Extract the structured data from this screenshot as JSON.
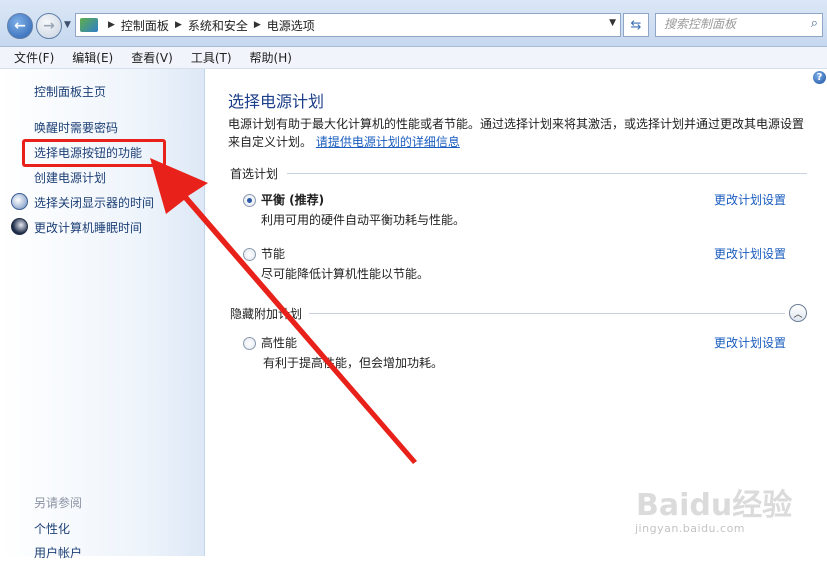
{
  "address_bar": {
    "crumbs": [
      "控制面板",
      "系统和安全",
      "电源选项"
    ],
    "search_placeholder": "搜索控制面板"
  },
  "menu": {
    "items": [
      "文件(F)",
      "编辑(E)",
      "查看(V)",
      "工具(T)",
      "帮助(H)"
    ]
  },
  "sidebar": {
    "links": [
      "控制面板主页",
      "唤醒时需要密码",
      "选择电源按钮的功能",
      "创建电源计划",
      "选择关闭显示器的时间",
      "更改计算机睡眠时间"
    ],
    "see_also_label": "另请参阅",
    "see_also": [
      "个性化",
      "用户帐户"
    ]
  },
  "main": {
    "title": "选择电源计划",
    "description": "电源计划有助于最大化计算机的性能或者节能。通过选择计划来将其激活，或选择计划并通过更改其电源设置来自定义计划。",
    "info_link": "请提供电源计划的详细信息",
    "preferred_group": "首选计划",
    "hidden_group": "隐藏附加计划",
    "plans": [
      {
        "name": "平衡 (推荐)",
        "desc": "利用可用的硬件自动平衡功耗与性能。",
        "selected": true,
        "change": "更改计划设置"
      },
      {
        "name": "节能",
        "desc": "尽可能降低计算机性能以节能。",
        "selected": false,
        "change": "更改计划设置"
      },
      {
        "name": "高性能",
        "desc": "有利于提高性能，但会增加功耗。",
        "selected": false,
        "change": "更改计划设置"
      }
    ]
  },
  "watermark": {
    "brand": "Baidu经验",
    "url": "jingyan.baidu.com"
  },
  "colors": {
    "link": "#1a5dbf",
    "title": "#1c3f8a",
    "annotation": "#e8221a"
  }
}
